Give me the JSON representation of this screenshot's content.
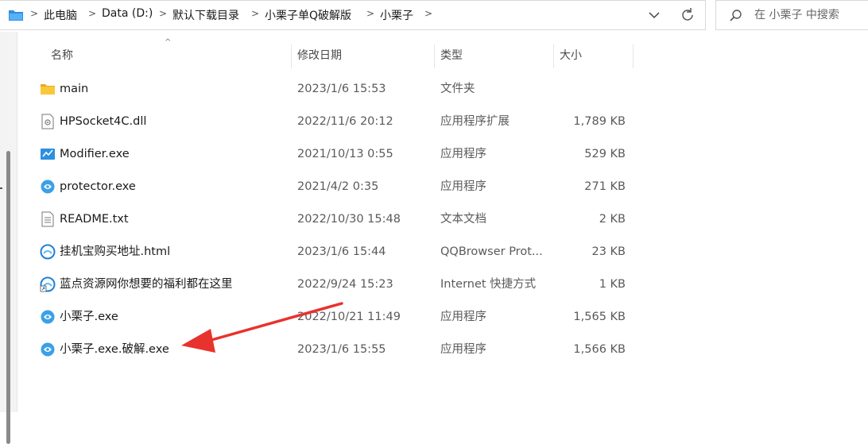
{
  "address_bar": {
    "breadcrumbs": [
      "此电脑",
      "Data (D:)",
      "默认下载目录",
      "小栗子单Q破解版",
      "小栗子"
    ]
  },
  "search": {
    "placeholder": "在 小栗子 中搜索"
  },
  "columns": {
    "name": "名称",
    "modified": "修改日期",
    "type": "类型",
    "size": "大小"
  },
  "files": [
    {
      "name": "main",
      "modified": "2023/1/6 15:53",
      "type": "文件夹",
      "size": "",
      "icon": "folder-icon"
    },
    {
      "name": "HPSocket4C.dll",
      "modified": "2022/11/6 20:12",
      "type": "应用程序扩展",
      "size": "1,789 KB",
      "icon": "dll-file-icon"
    },
    {
      "name": "Modifier.exe",
      "modified": "2021/10/13 0:55",
      "type": "应用程序",
      "size": "529 KB",
      "icon": "modifier-app-icon"
    },
    {
      "name": "protector.exe",
      "modified": "2021/4/2 0:35",
      "type": "应用程序",
      "size": "271 KB",
      "icon": "chestnut-app-icon"
    },
    {
      "name": "README.txt",
      "modified": "2022/10/30 15:48",
      "type": "文本文档",
      "size": "2 KB",
      "icon": "text-file-icon"
    },
    {
      "name": "挂机宝购买地址.html",
      "modified": "2023/1/6 15:44",
      "type": "QQBrowser Prot...",
      "size": "23 KB",
      "icon": "qqbrowser-html-icon"
    },
    {
      "name": "蓝点资源网你想要的福利都在这里",
      "modified": "2022/9/24 15:23",
      "type": "Internet 快捷方式",
      "size": "1 KB",
      "icon": "internet-shortcut-icon"
    },
    {
      "name": "小栗子.exe",
      "modified": "2022/10/21 11:49",
      "type": "应用程序",
      "size": "1,565 KB",
      "icon": "chestnut-app-icon"
    },
    {
      "name": "小栗子.exe.破解.exe",
      "modified": "2023/1/6 15:55",
      "type": "应用程序",
      "size": "1,566 KB",
      "icon": "chestnut-app-icon"
    }
  ],
  "colors": {
    "accent": "#0078d4",
    "folder": "#f8c73c",
    "annotation_arrow": "#e8322d",
    "app_icon": "#3aa0e8"
  }
}
